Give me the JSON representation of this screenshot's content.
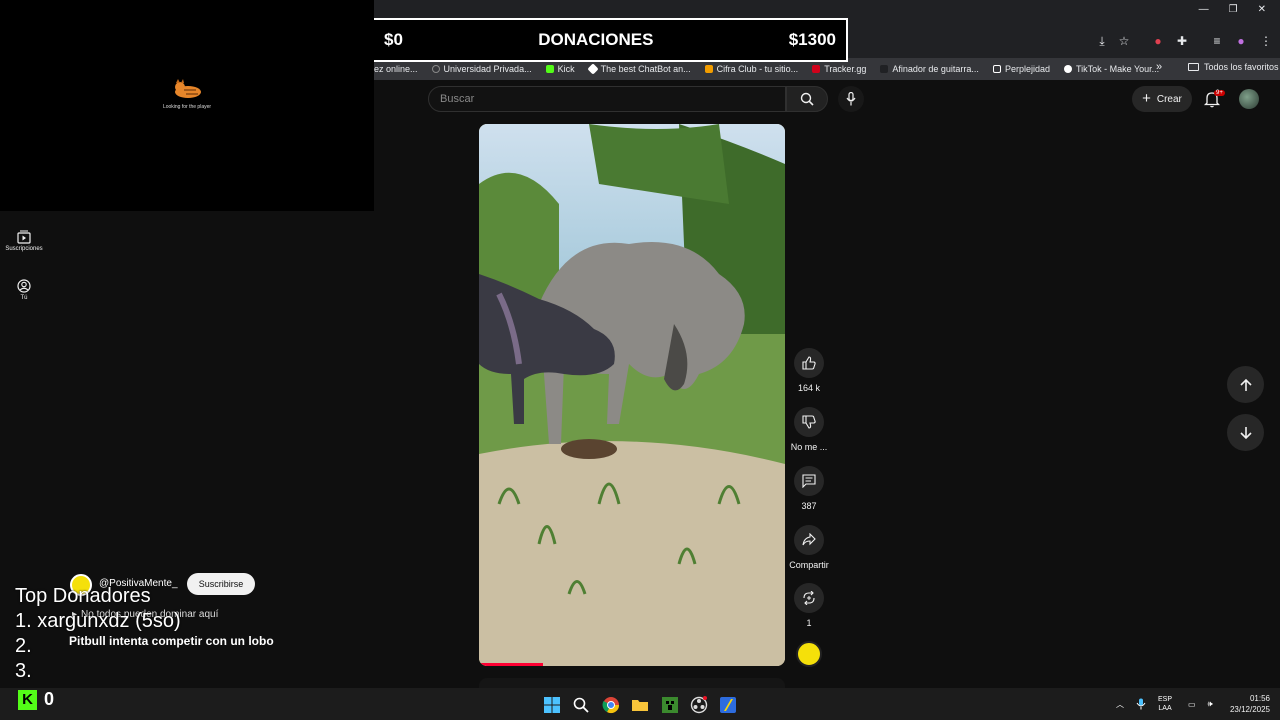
{
  "donation_bar": {
    "left_amount": "$0",
    "title": "DONACIONES",
    "right_amount": "$1300"
  },
  "bookmarks": [
    {
      "label": "ez online...",
      "color": "#5f6368"
    },
    {
      "label": "Universidad Privada...",
      "color": "#5f6368"
    },
    {
      "label": "Kick",
      "color": "#53fc18"
    },
    {
      "label": "The best ChatBot an...",
      "color": "#ffffff"
    },
    {
      "label": "Cifra Club - tu sitio...",
      "color": "#f29d00"
    },
    {
      "label": "Tracker.gg",
      "color": "#d0021b"
    },
    {
      "label": "Afinador de guitarra...",
      "color": "#202124"
    },
    {
      "label": "Perplejidad",
      "color": "#ffffff"
    },
    {
      "label": "TikTok - Make Your...",
      "color": "#ffffff"
    }
  ],
  "bookmarks_all": "Todos los favoritos",
  "webcam": {
    "caption": "Looking for the player"
  },
  "search": {
    "placeholder": "Buscar"
  },
  "header": {
    "create_label": "Crear",
    "notif_badge": "9+"
  },
  "guide": [
    {
      "label": "Suscripciones",
      "icon": "subscriptions-icon"
    },
    {
      "label": "Tú",
      "icon": "you-icon"
    }
  ],
  "actions": {
    "likes": "164 k",
    "dislike_label": "No me ...",
    "comments": "387",
    "share_label": "Compartir",
    "remix_count": "1"
  },
  "short": {
    "channel": "@PositivaMente_",
    "subscribe_label": "Suscribirse",
    "music": "No todos pueden dominar aquí",
    "title": "Pitbull intenta competir con un lobo",
    "progress": 0.21
  },
  "donors": {
    "title": "Top Donadores",
    "entries": [
      "1. xargunxdz (5so)",
      "2.",
      "3."
    ]
  },
  "kick": {
    "count": "0"
  },
  "tray": {
    "lang_top": "ESP",
    "lang_bottom": "LAA",
    "time": "01:56",
    "date": "23/12/2025"
  }
}
